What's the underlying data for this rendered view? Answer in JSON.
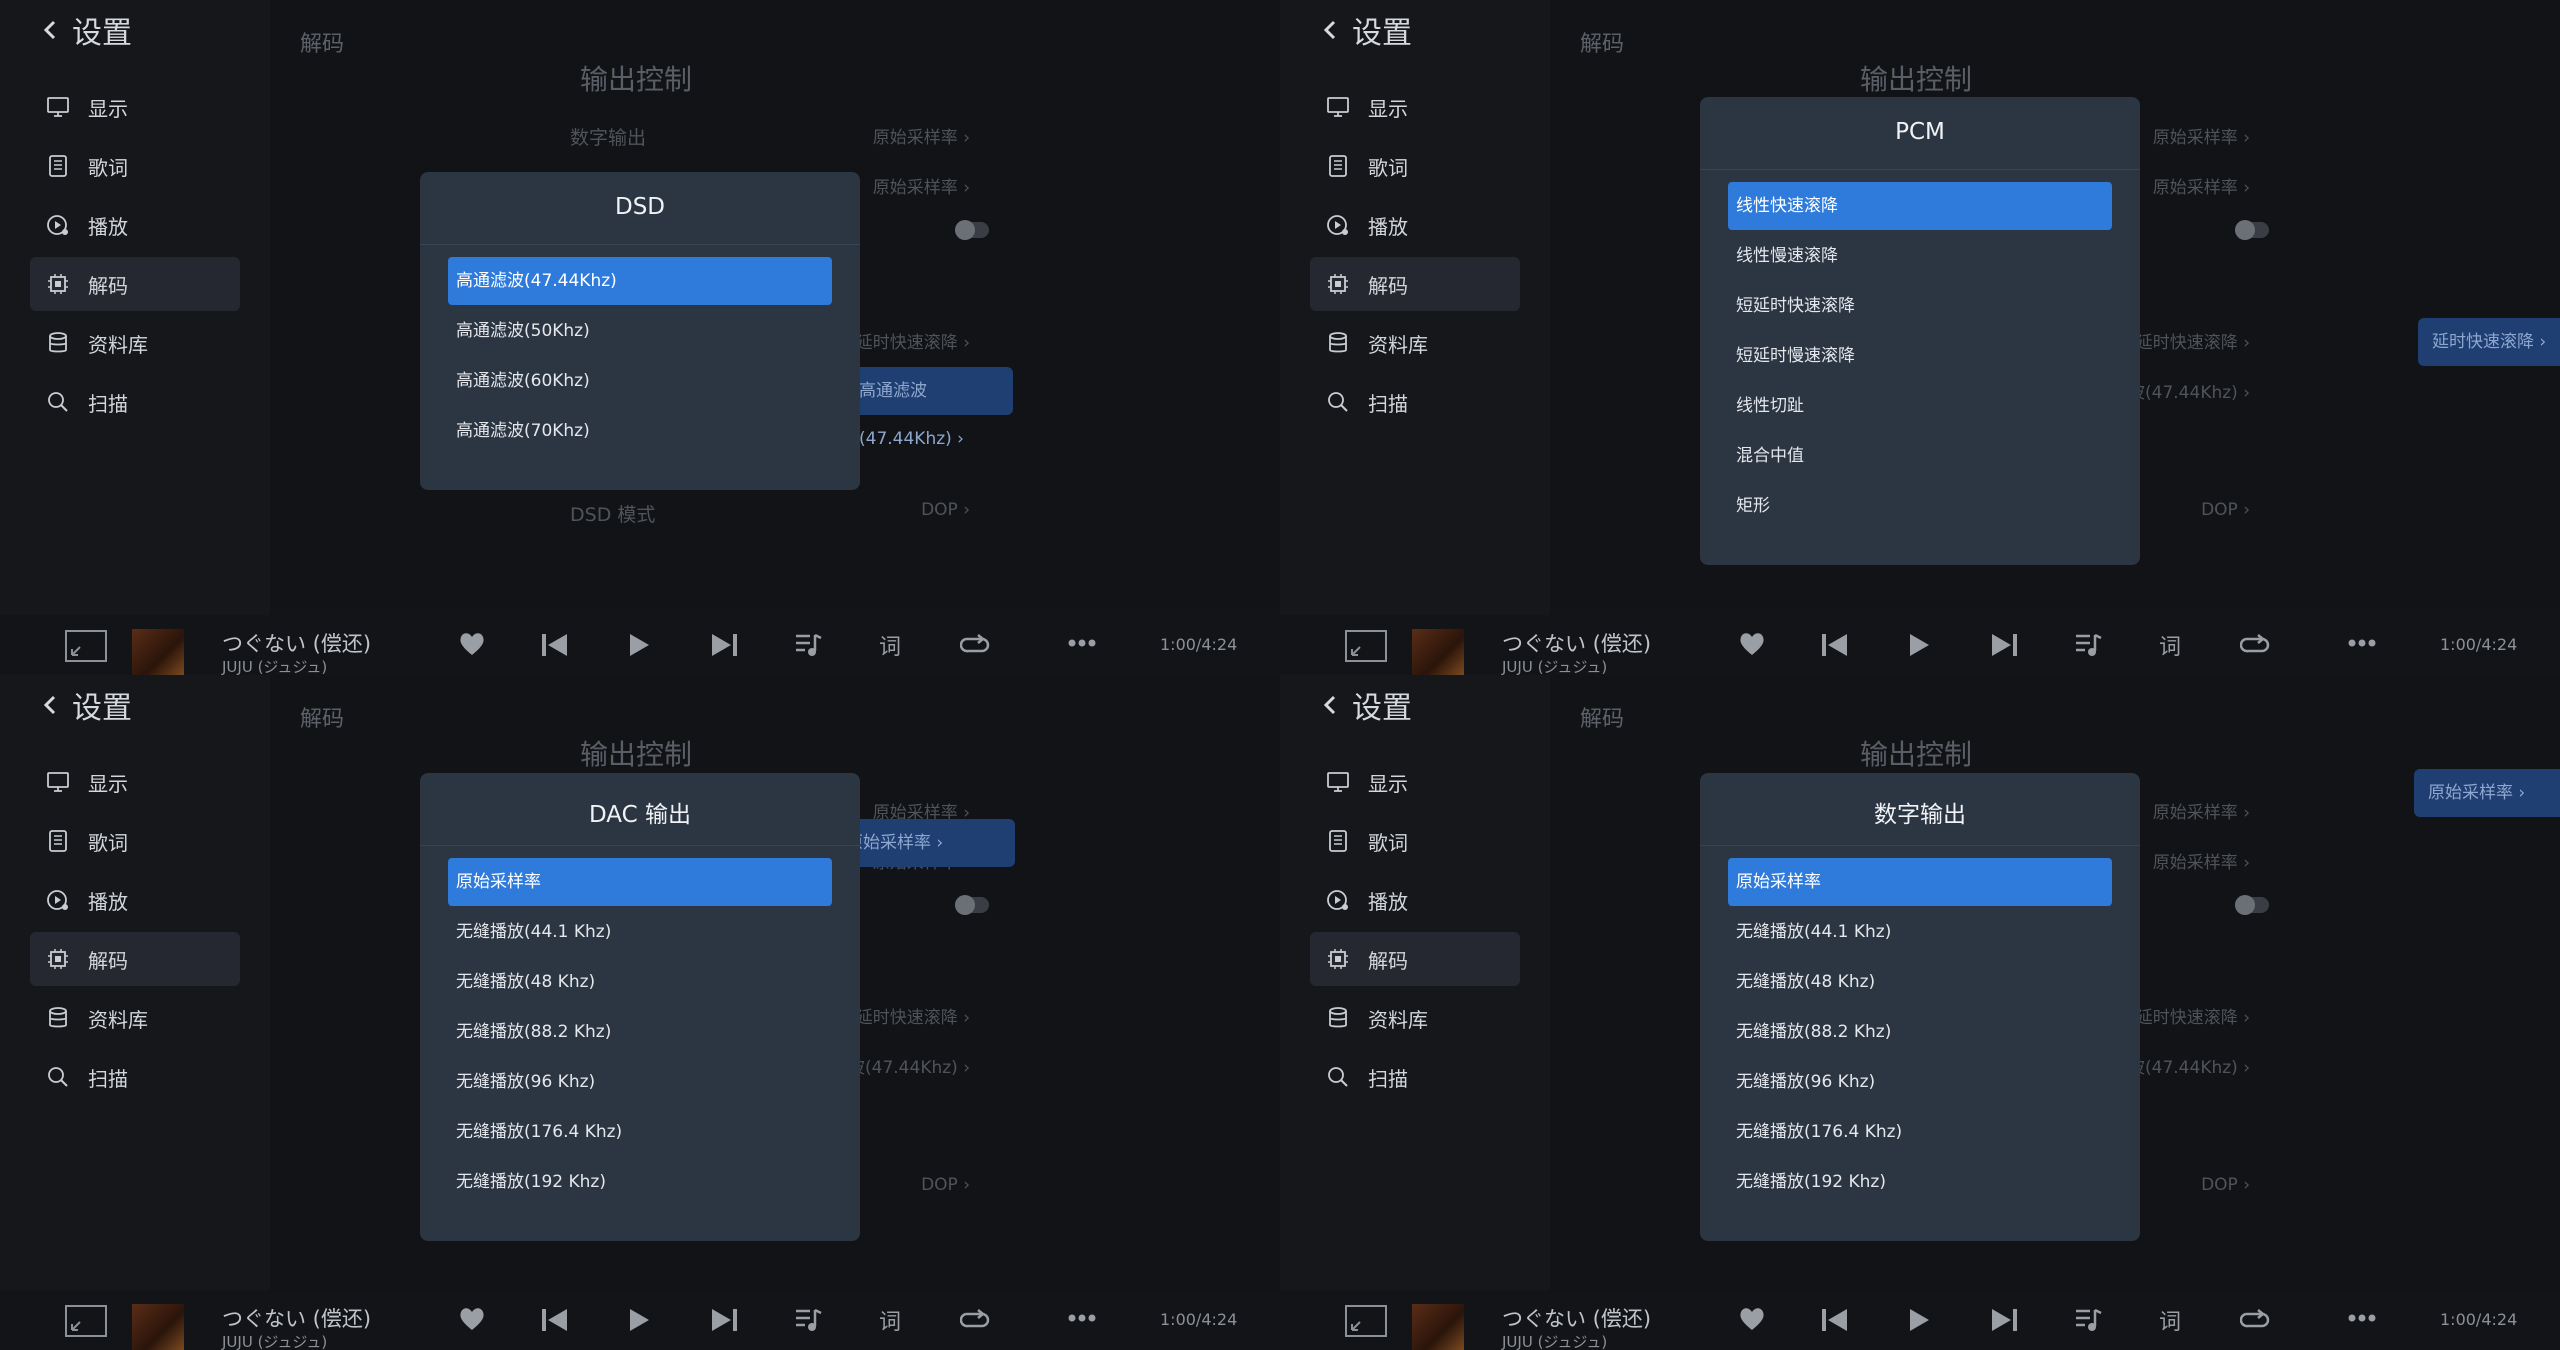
{
  "app": {
    "back_label": "设置",
    "breadcrumb": "解码",
    "sidebar": [
      {
        "label": "显示",
        "icon": "monitor-icon"
      },
      {
        "label": "歌词",
        "icon": "lyrics-icon"
      },
      {
        "label": "播放",
        "icon": "play-settings-icon"
      },
      {
        "label": "解码",
        "icon": "chip-icon"
      },
      {
        "label": "资料库",
        "icon": "database-icon"
      },
      {
        "label": "扫描",
        "icon": "search-icon"
      }
    ],
    "active_sidebar_index": 3,
    "section_title": "输出控制",
    "settings": {
      "digital_output_label": "数字输出",
      "digital_output_value": "原始采样率",
      "dac_output_value": "原始采样率",
      "pcm_value": "延时快速滚降",
      "pcm_value_full": "短延时快速滚降",
      "dsd_value": "高通滤波(47.44Khz)",
      "dsd_mode_label": "DSD 模式",
      "dsd_mode_value": "DOP"
    },
    "player": {
      "song": "つぐない (偿还)",
      "artist": "JUJU (ジュジュ)",
      "time": "1:00/4:24"
    }
  },
  "dialogs": [
    {
      "title": "DSD",
      "selected": 0,
      "options": [
        "高通滤波(47.44Khz)",
        "高通滤波(50Khz)",
        "高通滤波(60Khz)",
        "高通滤波(70Khz)"
      ]
    },
    {
      "title": "PCM",
      "selected": 0,
      "options": [
        "线性快速滚降",
        "线性慢速滚降",
        "短延时快速滚降",
        "短延时慢速滚降",
        "线性切趾",
        "混合中值",
        "矩形"
      ]
    },
    {
      "title": "DAC 输出",
      "selected": 0,
      "options": [
        "原始采样率",
        "无缝播放(44.1 Khz)",
        "无缝播放(48 Khz)",
        "无缝播放(88.2 Khz)",
        "无缝播放(96 Khz)",
        "无缝播放(176.4 Khz)",
        "无缝播放(192 Khz)"
      ]
    },
    {
      "title": "数字输出",
      "selected": 0,
      "options": [
        "原始采样率",
        "无缝播放(44.1 Khz)",
        "无缝播放(48 Khz)",
        "无缝播放(88.2 Khz)",
        "无缝播放(96 Khz)",
        "无缝播放(176.4 Khz)",
        "无缝播放(192 Khz)"
      ]
    }
  ],
  "colors": {
    "accent": "#2f7bdc",
    "modal_bg": "#2c3643",
    "page_bg": "#111316"
  }
}
